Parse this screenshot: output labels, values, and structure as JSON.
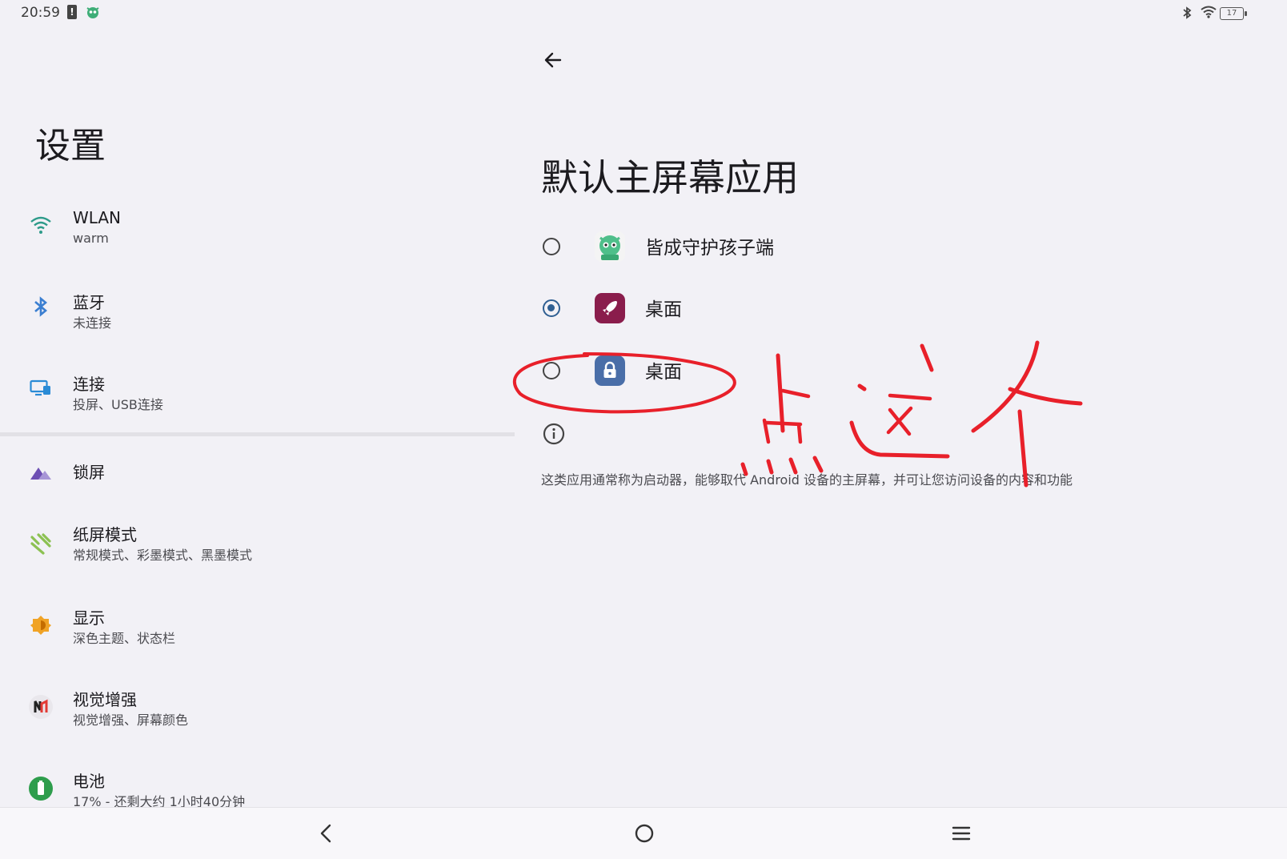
{
  "status_bar": {
    "time": "20:59",
    "alert_glyph": "!",
    "battery_level": "17",
    "icons": [
      "alert-icon",
      "app-status-icon",
      "bluetooth-icon",
      "wifi-icon",
      "battery-icon"
    ]
  },
  "left_panel": {
    "title": "设置",
    "items": [
      {
        "label": "WLAN",
        "sub": "warm",
        "icon": "wifi-icon"
      },
      {
        "label": "蓝牙",
        "sub": "未连接",
        "icon": "bluetooth-icon"
      },
      {
        "label": "连接",
        "sub": "投屏、USB连接",
        "icon": "screen-cast-icon"
      },
      {
        "label": "锁屏",
        "sub": "",
        "icon": "lock-screen-icon"
      },
      {
        "label": "纸屏模式",
        "sub": "常规模式、彩墨模式、黑墨模式",
        "icon": "paper-mode-icon"
      },
      {
        "label": "显示",
        "sub": "深色主题、状态栏",
        "icon": "display-icon"
      },
      {
        "label": "视觉增强",
        "sub": "视觉增强、屏幕颜色",
        "icon": "vision-enhance-icon"
      },
      {
        "label": "电池",
        "sub": "17% - 还剩大约 1小时40分钟",
        "icon": "battery-icon"
      }
    ]
  },
  "right_panel": {
    "title": "默认主屏幕应用",
    "options": [
      {
        "name": "皆成守护孩子端",
        "selected": false,
        "icon": "guardian-kid-app-icon"
      },
      {
        "name": "桌面",
        "selected": true,
        "icon": "rocket-launcher-icon"
      },
      {
        "name": "桌面",
        "selected": false,
        "icon": "lock-launcher-icon"
      }
    ],
    "info_text": "这类应用通常称为启动器，能够取代 Android 设备的主屏幕，并可让您访问设备的内容和功能"
  },
  "annotation": {
    "handwritten_text": "点这个",
    "color": "#e8202a"
  },
  "nav_bar": {
    "buttons": [
      "back-nav-icon",
      "home-nav-icon",
      "menu-nav-icon"
    ]
  },
  "colors": {
    "background": "#f2f1f6",
    "accent": "#2f5f92",
    "annotation_red": "#e8202a"
  }
}
